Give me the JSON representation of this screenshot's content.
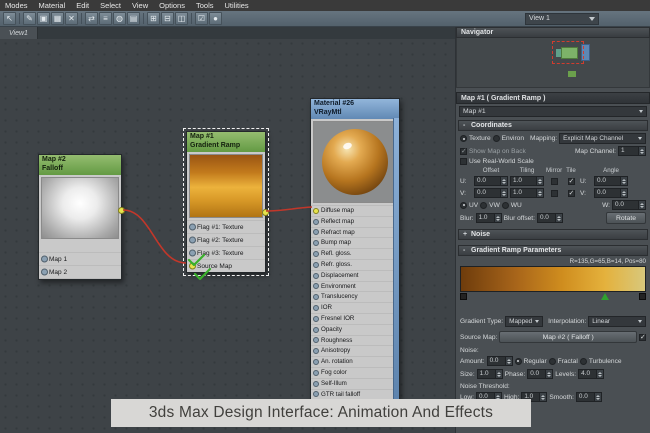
{
  "menu": {
    "items": [
      "Modes",
      "Material",
      "Edit",
      "Select",
      "View",
      "Options",
      "Tools",
      "Utilities"
    ]
  },
  "toolbar": {
    "icons": [
      "↖",
      "✎",
      "▣",
      "▦",
      "✕",
      "⇄",
      "≡",
      "◍",
      "▤",
      "⊞",
      "⊟",
      "◫",
      "☑",
      "●"
    ],
    "view_select": "View 1"
  },
  "viewport": {
    "tab": "View1"
  },
  "navigator": {
    "title": "Navigator"
  },
  "nodes": {
    "falloff": {
      "title": "Map #2",
      "subtitle": "Falloff",
      "slots": [
        "Map 1",
        "Map 2"
      ]
    },
    "gradient_ramp": {
      "title": "Map #1",
      "subtitle": "Gradient Ramp",
      "slots": [
        "Flag #1: Texture",
        "Flag #2: Texture",
        "Flag #3: Texture",
        "Source Map"
      ]
    },
    "vray": {
      "title": "Material #26",
      "subtitle": "VRayMtl",
      "slots": [
        "Diffuse map",
        "Reflect map",
        "Refract map",
        "Bump map",
        "Refl. gloss.",
        "Refr. gloss.",
        "Displacement",
        "Environment",
        "Translucency",
        "IOR",
        "Fresnel IOR",
        "Opacity",
        "Roughness",
        "Anisotropy",
        "An. rotation",
        "Fog color",
        "Self-Illum",
        "GTR tail falloff"
      ]
    }
  },
  "params": {
    "title": "Map #1  ( Gradient Ramp )",
    "map_selector": "Map #1",
    "coordinates": {
      "state": "-",
      "header": "Coordinates",
      "texture": "Texture",
      "environ": "Environ",
      "mapping_label": "Mapping:",
      "mapping": "Explicit Map Channel",
      "show_map": "Show Map on Back",
      "map_channel_label": "Map Channel:",
      "map_channel": "1",
      "real_world": "Use Real-World Scale",
      "col_offset": "Offset",
      "col_tiling": "Tiling",
      "col_mirror": "Mirror",
      "col_tile": "Tile",
      "col_angle": "Angle",
      "u": {
        "label": "U:",
        "offset": "0.0",
        "tiling": "1.0",
        "angle": "0.0"
      },
      "v": {
        "label": "V:",
        "offset": "0.0",
        "tiling": "1.0",
        "angle": "0.0"
      },
      "w": {
        "label": "W:",
        "angle": "0.0"
      },
      "uv": "UV",
      "vw": "VW",
      "wu": "WU",
      "blur_label": "Blur:",
      "blur": "1.0",
      "blur_offset_label": "Blur offset:",
      "blur_offset": "0.0",
      "rotate": "Rotate"
    },
    "noise": {
      "state": "+",
      "header": "Noise"
    },
    "gradient": {
      "state": "-",
      "header": "Gradient Ramp Parameters",
      "rgb_info": "R=135,G=65,B=14, Pos=80",
      "type_label": "Gradient Type:",
      "type": "Mapped",
      "interp_label": "Interpolation:",
      "interp": "Linear",
      "source_label": "Source Map:",
      "source": "Map #2  ( Falloff )",
      "noise_label": "Noise:",
      "amount_label": "Amount:",
      "amount": "0.0",
      "regular": "Regular",
      "fractal": "Fractal",
      "turbulence": "Turbulence",
      "size_label": "Size:",
      "size": "1.0",
      "phase_label": "Phase:",
      "phase": "0.0",
      "levels_label": "Levels:",
      "levels": "4.0",
      "threshold_label": "Noise Threshold:",
      "low_label": "Low:",
      "low": "0.0",
      "high_label": "High:",
      "high": "1.0",
      "smooth_label": "Smooth:",
      "smooth": "0.0"
    }
  },
  "caption": "3ds Max Design Interface: Animation And Effects",
  "colors": {
    "map_node_header": "#79a858",
    "material_node_header": "#7fa3c9",
    "wire": "#c2372a",
    "selection_dash": "#f0f0f0"
  }
}
